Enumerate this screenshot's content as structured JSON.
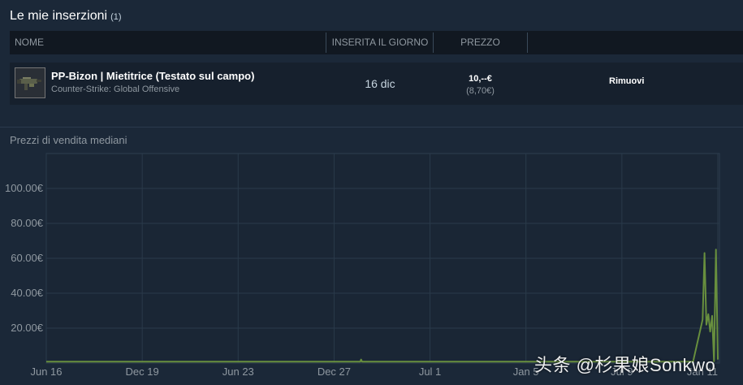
{
  "section": {
    "title": "Le mie inserzioni",
    "count": "(1)"
  },
  "table": {
    "headers": {
      "name": "NOME",
      "date": "INSERITA IL GIORNO",
      "price": "PREZZO"
    }
  },
  "listing": {
    "name": "PP-Bizon | Mietitrice (Testato sul campo)",
    "game": "Counter-Strike: Global Offensive",
    "date": "16 dic",
    "price": "10,--€",
    "price_sub": "(8,70€)",
    "remove_label": "Rimuovi"
  },
  "chart_title": "Prezzi di vendita mediani",
  "watermark": "头条 @杉果娘Sonkwo",
  "chart_data": {
    "type": "line",
    "title": "Prezzi di vendita mediani",
    "xlabel": "",
    "ylabel": "",
    "ylim": [
      0,
      120
    ],
    "y_ticks": [
      "20.00€",
      "40.00€",
      "60.00€",
      "80.00€",
      "100.00€"
    ],
    "y_tick_values": [
      20,
      40,
      60,
      80,
      100
    ],
    "x_ticks": [
      "Jun 16",
      "Dec 19",
      "Jun 23",
      "Dec 27",
      "Jul 1",
      "Jan 5",
      "Jul 9",
      "Jan 11"
    ],
    "grid": true,
    "series": [
      {
        "color": "#688f3e",
        "x": [
          0,
          100,
          200,
          300,
          330,
          331,
          332,
          400,
          500,
          600,
          680,
          690,
          692,
          694,
          696,
          698,
          700,
          702,
          704,
          706
        ],
        "y": [
          0.8,
          0.8,
          0.8,
          0.8,
          0.8,
          2.0,
          0.8,
          0.8,
          0.8,
          0.8,
          0.8,
          25,
          63,
          22,
          28,
          18,
          27,
          1,
          65,
          2
        ]
      }
    ]
  }
}
